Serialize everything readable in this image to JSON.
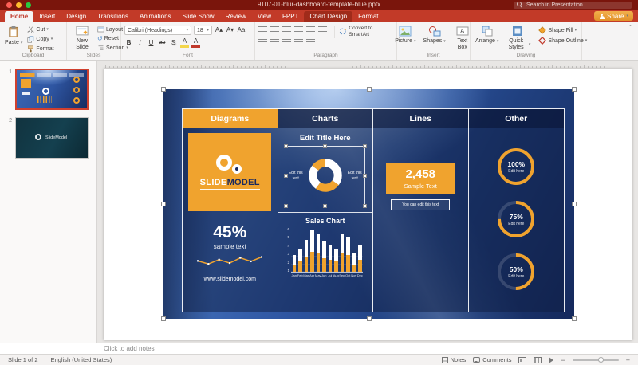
{
  "titlebar": {
    "filename": "9107-01-blur-dashboard-template-blue.pptx",
    "search_placeholder": "Search in Presentation"
  },
  "tabbar": {
    "tabs": [
      "Home",
      "Insert",
      "Design",
      "Transitions",
      "Animations",
      "Slide Show",
      "Review",
      "View",
      "FPPT",
      "Chart Design",
      "Format"
    ],
    "active_tab": "Home",
    "highlighted_tab": "Chart Design",
    "share_label": "Share"
  },
  "ribbon": {
    "clipboard": {
      "label": "Clipboard",
      "paste": "Paste",
      "cut": "Cut",
      "copy": "Copy",
      "format": "Format"
    },
    "slides": {
      "label": "Slides",
      "new_slide": "New Slide",
      "layout": "Layout",
      "reset": "Reset",
      "section": "Section"
    },
    "font": {
      "label": "Font",
      "font_name": "Calibri (Headings)",
      "font_size": "18"
    },
    "paragraph": {
      "label": "Paragraph",
      "smartart": "Convert to SmartArt"
    },
    "insert_group": {
      "label": "Insert",
      "picture": "Picture",
      "shapes": "Shapes",
      "textbox": "Text Box"
    },
    "drawing": {
      "label": "Drawing",
      "arrange": "Arrange",
      "quick_styles": "Quick Styles",
      "shape_fill": "Shape Fill",
      "shape_outline": "Shape Outline"
    }
  },
  "icons": {
    "caret": "▾",
    "collapse": "ˆ",
    "bold": "B",
    "italic": "I",
    "underline": "U",
    "strikethrough": "ab",
    "shadow": "S",
    "font_increase": "A▴",
    "font_decrease": "A▾",
    "change_case": "Aa",
    "highlight": "A",
    "font_color": "A",
    "reset_arrow": "↺",
    "minus": "−",
    "plus": "+"
  },
  "sidebar": {
    "slides": [
      {
        "number": "1"
      },
      {
        "number": "2",
        "label": "SlideModel"
      }
    ]
  },
  "slide": {
    "headers": [
      "Diagrams",
      "Charts",
      "Lines",
      "Other"
    ],
    "diagrams_panel": {
      "logo_top": "SLIDE",
      "logo_bottom": "MODEL",
      "stat": "45%",
      "stat_caption": "sample text",
      "footer": "www.slidemodel.com"
    },
    "charts_panel": {
      "title": "Edit Title Here",
      "donut_left_label": "Edit this text",
      "donut_right_label": "Edit this text",
      "sales_title": "Sales Chart"
    },
    "lines_panel": {
      "stat": "2,458",
      "stat_caption": "Sample Text",
      "note": "You can edit this text"
    },
    "other_panel": {
      "gauges": [
        {
          "percent": 100,
          "label": "100%",
          "caption": "Edit here"
        },
        {
          "percent": 75,
          "label": "75%",
          "caption": "Edit here"
        },
        {
          "percent": 50,
          "label": "50%",
          "caption": "Edit here"
        }
      ]
    }
  },
  "chart_data": [
    {
      "type": "bar",
      "title": "Sales Chart",
      "categories": [
        "Jan",
        "Feb",
        "Mar",
        "Apr",
        "May",
        "Jun",
        "Jul",
        "Aug",
        "Sep",
        "Oct",
        "Nov",
        "Dec"
      ],
      "stacked": true,
      "ylim": [
        0,
        6
      ],
      "yticks": [
        1,
        2,
        3,
        4,
        5,
        6
      ],
      "series": [
        {
          "name": "bottom-orange",
          "color": "#F0A32E",
          "values": [
            1.0,
            1.4,
            2.0,
            2.6,
            2.4,
            1.8,
            1.6,
            1.4,
            2.4,
            2.2,
            1.0,
            1.6
          ]
        },
        {
          "name": "top-white",
          "color": "#FFFFFF",
          "values": [
            1.2,
            1.6,
            2.2,
            3.0,
            2.6,
            2.2,
            2.0,
            1.6,
            2.6,
            2.4,
            1.4,
            2.0
          ]
        }
      ]
    },
    {
      "type": "pie",
      "variant": "donut",
      "segments": [
        {
          "value": 35,
          "color": "#FFFFFF"
        },
        {
          "value": 25,
          "color": "#F0A32E"
        },
        {
          "value": 25,
          "color": "#FFFFFF"
        },
        {
          "value": 15,
          "color": "#F0A32E"
        }
      ]
    },
    {
      "type": "line",
      "color": "#F0A32E",
      "values": [
        1.5,
        0.8,
        1.8,
        1.0,
        2.2,
        1.4,
        2.4
      ]
    }
  ],
  "notes": {
    "placeholder": "Click to add notes"
  },
  "statusbar": {
    "slide_info": "Slide 1 of 2",
    "language": "English (United States)",
    "notes_label": "Notes",
    "comments_label": "Comments"
  },
  "colors": {
    "accent_orange": "#F0A32E",
    "ribbon_red": "#C23A28",
    "title_maroon": "#7A150C",
    "dashboard_blue": "#2E55A1"
  }
}
